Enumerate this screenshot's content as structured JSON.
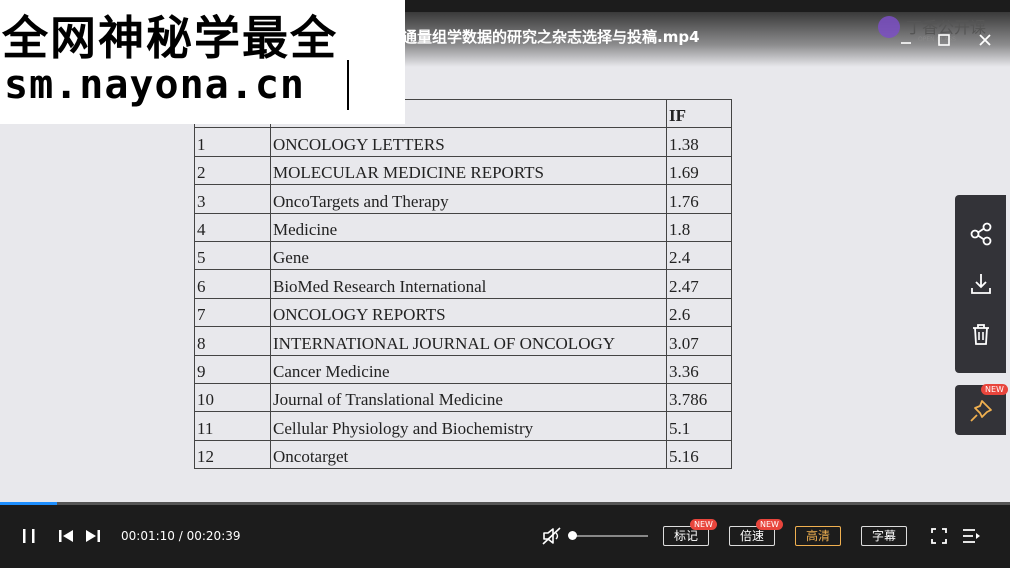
{
  "video": {
    "title": "通量组学数据的研究之杂志选择与投稿.mp4",
    "brand_name": "丁香公开课",
    "brand_sub": "OPEN CLASS"
  },
  "watermark": {
    "line1": "全网神秘学最全",
    "line2": "sm.nayona.cn"
  },
  "table": {
    "headers": [
      "序号",
      "杂志",
      "IF"
    ],
    "rows": [
      [
        "1",
        "ONCOLOGY LETTERS",
        "1.38"
      ],
      [
        "2",
        "MOLECULAR MEDICINE REPORTS",
        "1.69"
      ],
      [
        "3",
        "OncoTargets and Therapy",
        "1.76"
      ],
      [
        "4",
        "Medicine",
        "1.8"
      ],
      [
        "5",
        "Gene",
        "2.4"
      ],
      [
        "6",
        "BioMed Research International",
        "2.47"
      ],
      [
        "7",
        "ONCOLOGY REPORTS",
        "2.6"
      ],
      [
        "8",
        "INTERNATIONAL JOURNAL OF ONCOLOGY",
        "3.07"
      ],
      [
        "9",
        "Cancer Medicine",
        "3.36"
      ],
      [
        "10",
        "Journal of Translational Medicine",
        "3.786"
      ],
      [
        "11",
        "Cellular Physiology and Biochemistry",
        "5.1"
      ],
      [
        "12",
        "Oncotarget",
        "5.16"
      ]
    ]
  },
  "side_panel": {
    "icons": [
      "share-icon",
      "download-icon",
      "delete-icon"
    ],
    "pin_badge": "NEW"
  },
  "player": {
    "current_time": "00:01:10",
    "separator": "/",
    "total_time": "00:20:39",
    "progress_fraction": 0.056,
    "volume_fraction": 0.0,
    "muted": true,
    "mark_label": "标记",
    "mark_badge": "NEW",
    "speed_label": "倍速",
    "speed_badge": "NEW",
    "quality_label": "高清",
    "subtitle_label": "字幕",
    "accent_color": "#1e8fff",
    "active_color": "#f0b050"
  }
}
